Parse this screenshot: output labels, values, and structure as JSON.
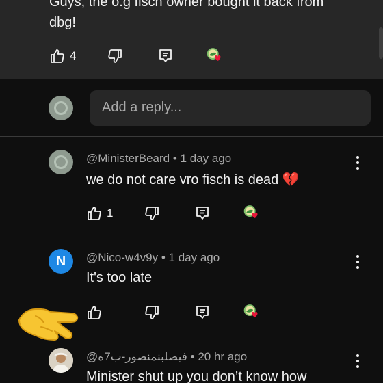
{
  "top_comment": {
    "text_line1": "Guys, the o.g fisch owner bought it back from",
    "text_line2": "dbg!",
    "like_count": "4"
  },
  "reply": {
    "placeholder": "Add a reply..."
  },
  "comments": [
    {
      "handle": "@MinisterBeard",
      "time": "1 day ago",
      "text": "we do not care vro fisch is dead 💔",
      "like_count": "1"
    },
    {
      "handle": "@Nico-w4v9y",
      "time": "1 day ago",
      "text": "It's too late",
      "like_count": "",
      "avatar_letter": "N"
    },
    {
      "handle": "@فيصلبنمنصور-ب7ه",
      "time": "20 hr ago",
      "text": "Minister shut up you don’t know how"
    }
  ],
  "colors": {
    "background": "#0f0f0f",
    "card": "#272727",
    "text_primary": "#f1f1f1",
    "text_secondary": "#aaaaaa",
    "heart": "#e8173a",
    "avatar_blue": "#1e88e5"
  },
  "icons": [
    "thumbs-up-icon",
    "thumbs-down-icon",
    "reply-icon",
    "creator-heart-icon",
    "more-vert-icon",
    "pointing-hand-emoji"
  ]
}
